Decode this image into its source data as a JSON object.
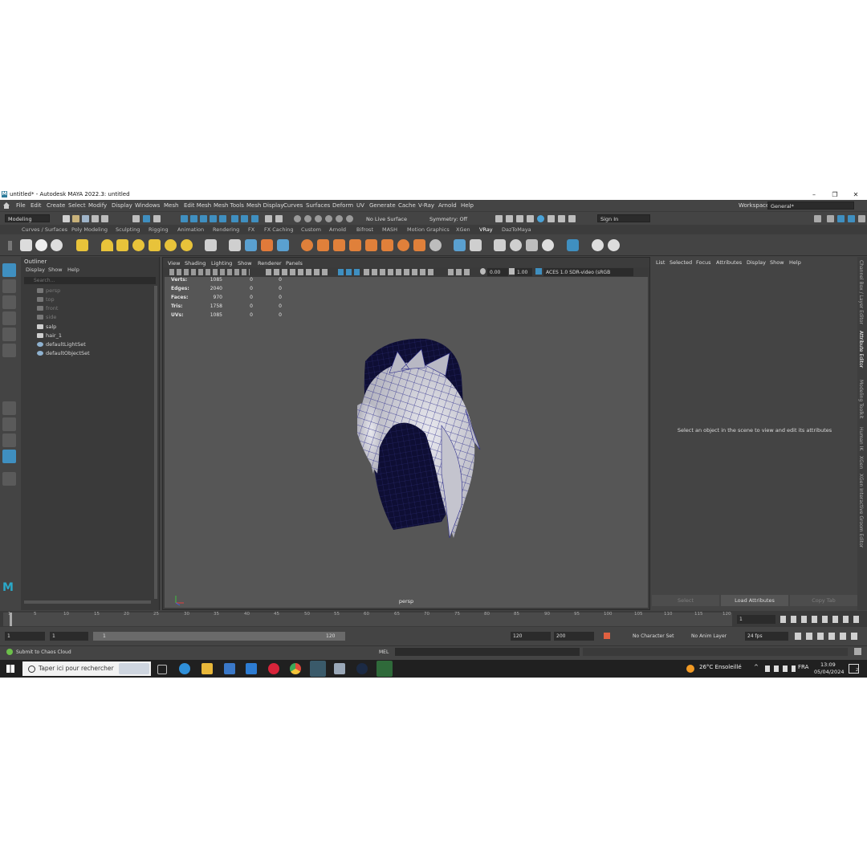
{
  "window": {
    "title": "untitled* - Autodesk MAYA 2022.3: untitled",
    "logo": "M",
    "controls": [
      "minimize-icon",
      "restore-icon",
      "close-icon"
    ]
  },
  "menu": [
    "File",
    "Edit",
    "Create",
    "Select",
    "Modify",
    "Display",
    "Windows",
    "Mesh",
    "Edit Mesh",
    "Mesh Tools",
    "Mesh Display",
    "Curves",
    "Surfaces",
    "Deform",
    "UV",
    "Generate",
    "Cache",
    "V-Ray",
    "Arnold",
    "Help"
  ],
  "workspace": {
    "label": "Workspace:",
    "value": "General*"
  },
  "status": {
    "mode": "Modeling",
    "live_surface": "No Live Surface",
    "symmetry": "Symmetry: Off",
    "signin": "Sign In"
  },
  "shelf_tabs": [
    "Curves / Surfaces",
    "Poly Modeling",
    "Sculpting",
    "Rigging",
    "Animation",
    "Rendering",
    "FX",
    "FX Caching",
    "Custom",
    "Arnold",
    "Bifrost",
    "MASH",
    "Motion Graphics",
    "XGen",
    "VRay",
    "DazToMaya"
  ],
  "shelf_active": "VRay",
  "outliner": {
    "title": "Outliner",
    "menu": [
      "Display",
      "Show",
      "Help"
    ],
    "search_placeholder": "Search...",
    "items": [
      {
        "label": "persp",
        "dim": true,
        "icon": "camera-icon"
      },
      {
        "label": "top",
        "dim": true,
        "icon": "camera-icon"
      },
      {
        "label": "front",
        "dim": true,
        "icon": "camera-icon"
      },
      {
        "label": "side",
        "dim": true,
        "icon": "camera-icon"
      },
      {
        "label": "salp",
        "dim": false,
        "icon": "transform-icon"
      },
      {
        "label": "hair_1",
        "dim": false,
        "icon": "transform-icon"
      },
      {
        "label": "defaultLightSet",
        "dim": false,
        "icon": "set-icon"
      },
      {
        "label": "defaultObjectSet",
        "dim": false,
        "icon": "set-icon"
      }
    ]
  },
  "viewport": {
    "menu": [
      "View",
      "Shading",
      "Lighting",
      "Show",
      "Renderer",
      "Panels"
    ],
    "exposure": "0.00",
    "gamma": "1.00",
    "colorspace": "ACES 1.0 SDR-video (sRGB",
    "camera": "persp",
    "hud": [
      {
        "label": "Verts:",
        "v1": "1085",
        "v2": "0",
        "v3": "0"
      },
      {
        "label": "Edges:",
        "v1": "2040",
        "v2": "0",
        "v3": "0"
      },
      {
        "label": "Faces:",
        "v1": "970",
        "v2": "0",
        "v3": "0"
      },
      {
        "label": "Tris:",
        "v1": "1758",
        "v2": "0",
        "v3": "0"
      },
      {
        "label": "UVs:",
        "v1": "1085",
        "v2": "0",
        "v3": "0"
      }
    ]
  },
  "attribute_editor": {
    "menu": [
      "List",
      "Selected",
      "Focus",
      "Attributes",
      "Display",
      "Show",
      "Help"
    ],
    "message": "Select an object in the scene to view and edit its attributes",
    "buttons": [
      "Select",
      "Load Attributes",
      "Copy Tab"
    ]
  },
  "right_tabs": [
    "Channel Box / Layer Editor",
    "Attribute Editor",
    "Modeling Toolkit",
    "Human IK",
    "XGen",
    "XGen Interactive Groom Editor"
  ],
  "timeline": {
    "ticks": [
      "5",
      "10",
      "15",
      "20",
      "25",
      "30",
      "35",
      "40",
      "45",
      "50",
      "55",
      "60",
      "65",
      "70",
      "75",
      "80",
      "85",
      "90",
      "95",
      "100",
      "105",
      "110",
      "115",
      "120"
    ],
    "start_tick": "1",
    "current_frame": "1"
  },
  "range": {
    "start": "1",
    "start2": "1",
    "slider_start": "1",
    "slider_end": "120",
    "end": "120",
    "end2": "200",
    "character_set": "No Character Set",
    "anim_layer": "No Anim Layer",
    "fps": "24 fps"
  },
  "cmdline": {
    "help": "Submit to Chaos Cloud",
    "lang": "MEL"
  },
  "taskbar": {
    "search": "Taper ici pour rechercher",
    "weather": "26°C  Ensoleillé",
    "lang": "FRA",
    "time": "13:09",
    "date": "05/04/2024",
    "notifications": "2"
  }
}
